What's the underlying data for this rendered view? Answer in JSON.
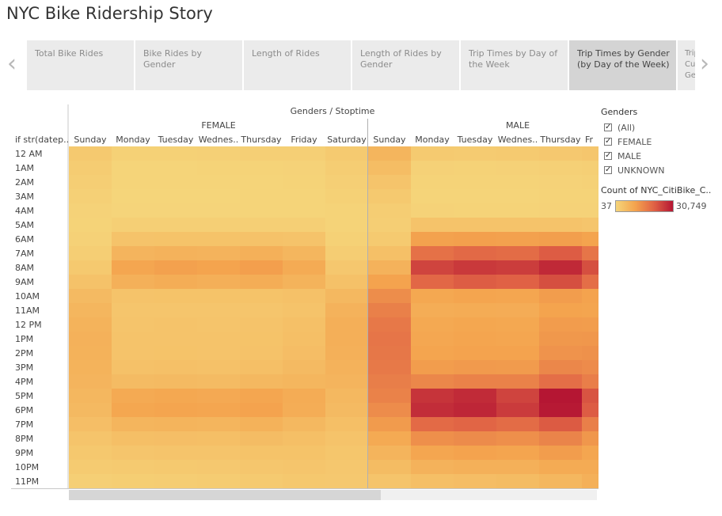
{
  "page_title": "NYC Bike Ridership Story",
  "nav": {
    "prev_arrow": "‹",
    "next_arrow": "›"
  },
  "tabs": [
    {
      "label": "Total Bike Rides",
      "active": false
    },
    {
      "label": "Bike Rides by Gender",
      "active": false
    },
    {
      "label": "Length of Rides",
      "active": false
    },
    {
      "label": "Length of Rides by Gender",
      "active": false
    },
    {
      "label": "Trip Times by Day of the Week",
      "active": false
    },
    {
      "label": "Trip Times by Gender (by Day of the Week)",
      "active": true
    },
    {
      "label": "Trip Cus Gen",
      "active": false
    }
  ],
  "legend": {
    "filter_title": "Genders",
    "filter_items": [
      {
        "label": "(All)",
        "checked": true
      },
      {
        "label": "FEMALE",
        "checked": true
      },
      {
        "label": "MALE",
        "checked": true
      },
      {
        "label": "UNKNOWN",
        "checked": true
      }
    ],
    "color_title": "Count of NYC_CitiBike_C...",
    "min_label": "37",
    "max_label": "30,749",
    "colors": [
      "#f5d57a",
      "#f4a44e",
      "#e06245",
      "#b51633"
    ]
  },
  "chart_data": {
    "type": "heatmap",
    "column_header": "Genders / Stoptime",
    "row_header": "if str(datep..",
    "groups": [
      {
        "name": "FEMALE",
        "days": [
          "Sunday",
          "Monday",
          "Tuesday",
          "Wednes..",
          "Thursday",
          "Friday",
          "Saturday"
        ]
      },
      {
        "name": "MALE",
        "days": [
          "Sunday",
          "Monday",
          "Tuesday",
          "Wednes..",
          "Thursday",
          "Fr"
        ]
      }
    ],
    "hours": [
      "12 AM",
      "1AM",
      "2AM",
      "3AM",
      "4AM",
      "5AM",
      "6AM",
      "7AM",
      "8AM",
      "9AM",
      "10AM",
      "11AM",
      "12 PM",
      "1PM",
      "2PM",
      "3PM",
      "4PM",
      "5PM",
      "6PM",
      "7PM",
      "8PM",
      "9PM",
      "10PM",
      "11PM"
    ],
    "color_min": 37,
    "color_max": 30749,
    "values": {
      "FEMALE": [
        [
          2500,
          900,
          900,
          1000,
          1200,
          1300,
          2300
        ],
        [
          1900,
          300,
          300,
          400,
          500,
          600,
          1700
        ],
        [
          1400,
          200,
          200,
          200,
          300,
          400,
          1300
        ],
        [
          1000,
          100,
          100,
          100,
          200,
          200,
          900
        ],
        [
          600,
          150,
          150,
          150,
          200,
          200,
          500
        ],
        [
          500,
          1300,
          1300,
          1300,
          1300,
          1200,
          500
        ],
        [
          800,
          3800,
          3900,
          3900,
          4000,
          3700,
          900
        ],
        [
          1500,
          6900,
          7300,
          7100,
          7800,
          6500,
          1700
        ],
        [
          2600,
          9800,
          10700,
          10200,
          11000,
          8900,
          2900
        ],
        [
          4000,
          7700,
          8300,
          8000,
          8300,
          7200,
          4300
        ],
        [
          5600,
          3800,
          3900,
          3900,
          3900,
          4300,
          6200
        ],
        [
          6600,
          3300,
          3400,
          3300,
          3400,
          3800,
          7300
        ],
        [
          7200,
          3600,
          3700,
          3600,
          3800,
          4400,
          7900
        ],
        [
          7500,
          3700,
          3800,
          3700,
          3900,
          4700,
          8000
        ],
        [
          7400,
          3800,
          3900,
          3800,
          4100,
          5000,
          7700
        ],
        [
          7200,
          4300,
          4400,
          4300,
          4700,
          5600,
          7300
        ],
        [
          6900,
          5500,
          5700,
          5500,
          6200,
          6600,
          6900
        ],
        [
          6400,
          9000,
          9500,
          9200,
          9800,
          8700,
          6200
        ],
        [
          5800,
          9700,
          10100,
          9800,
          10500,
          8400,
          5600
        ],
        [
          4800,
          6700,
          7000,
          6800,
          7400,
          6200,
          4700
        ],
        [
          3600,
          4600,
          4800,
          4700,
          5200,
          4700,
          3700
        ],
        [
          2800,
          3300,
          3500,
          3500,
          3900,
          3900,
          3200
        ],
        [
          2100,
          2400,
          2600,
          2700,
          3100,
          3400,
          2900
        ],
        [
          1300,
          1600,
          1700,
          1900,
          2300,
          2800,
          2700
        ]
      ],
      "MALE": [
        [
          6800,
          2300,
          2100,
          2400,
          2700,
          3100
        ],
        [
          5100,
          800,
          700,
          800,
          1000,
          1300
        ],
        [
          3600,
          500,
          400,
          500,
          600,
          800
        ],
        [
          2500,
          300,
          300,
          300,
          400,
          500
        ],
        [
          1700,
          600,
          500,
          500,
          600,
          600
        ],
        [
          1400,
          3700,
          3700,
          3700,
          3800,
          3400
        ],
        [
          2400,
          10600,
          10900,
          10700,
          11100,
          10200
        ],
        [
          4500,
          18200,
          19500,
          19000,
          21300,
          17500
        ],
        [
          7300,
          24600,
          26000,
          25500,
          28200,
          23100
        ],
        [
          10500,
          19700,
          21200,
          20600,
          23100,
          18700
        ],
        [
          13800,
          9500,
          10100,
          9800,
          11400,
          10500
        ],
        [
          15900,
          8300,
          8700,
          8500,
          10300,
          10000
        ],
        [
          17100,
          9300,
          9700,
          9500,
          11500,
          11300
        ],
        [
          17500,
          9600,
          10000,
          9900,
          12100,
          12300
        ],
        [
          17300,
          10100,
          10500,
          10400,
          12900,
          13200
        ],
        [
          16900,
          11300,
          11800,
          11700,
          14800,
          14100
        ],
        [
          16200,
          14800,
          15600,
          15500,
          18600,
          16100
        ],
        [
          15500,
          26700,
          27900,
          24500,
          30749,
          22400
        ],
        [
          14000,
          27600,
          28600,
          25800,
          30300,
          21300
        ],
        [
          11700,
          19200,
          20100,
          18900,
          21500,
          16000
        ],
        [
          9000,
          13600,
          14200,
          13600,
          15300,
          12300
        ],
        [
          7000,
          9900,
          10400,
          10100,
          11400,
          9800
        ],
        [
          5300,
          7300,
          7700,
          7700,
          8800,
          8800
        ],
        [
          3500,
          4700,
          5000,
          5300,
          6400,
          7800
        ]
      ]
    }
  }
}
